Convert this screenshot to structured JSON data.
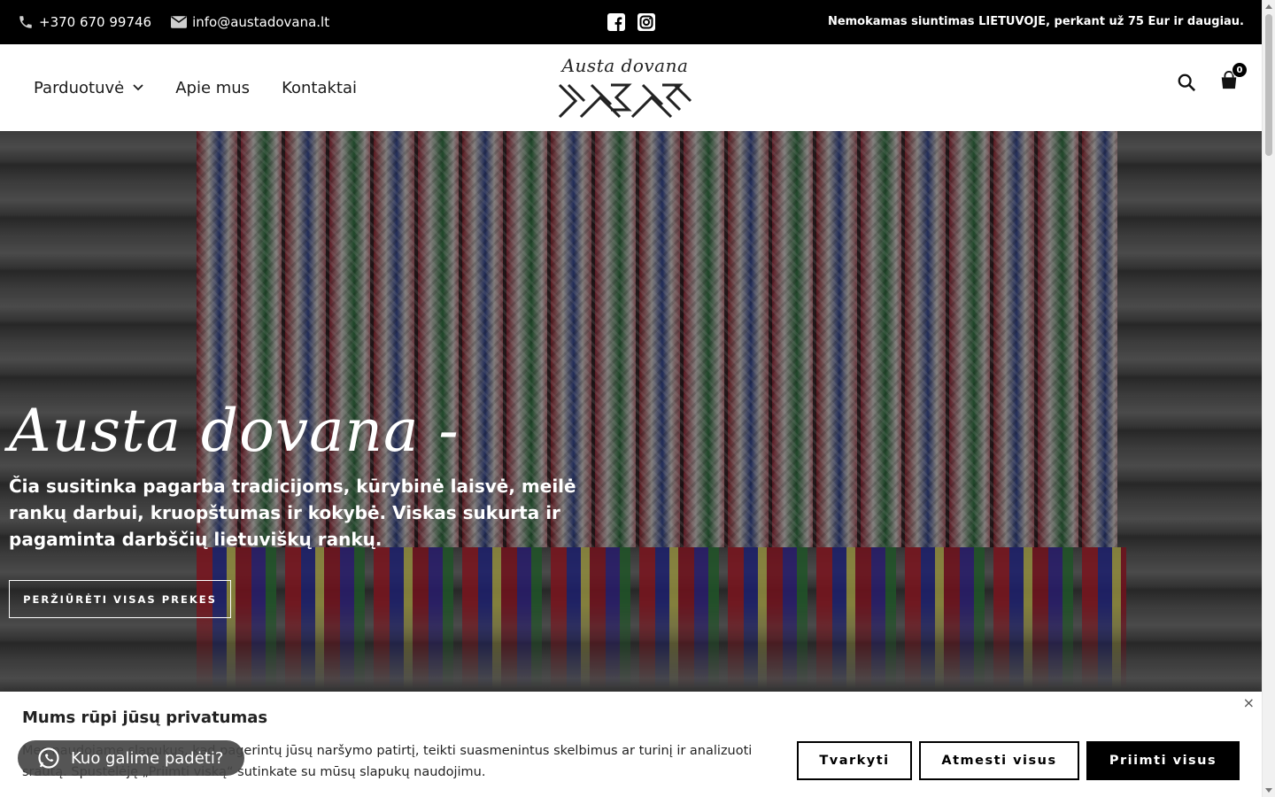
{
  "topbar": {
    "phone": "+370 670 99746",
    "email": "info@austadovana.lt",
    "notice": "Nemokamas siuntimas LIETUVOJE, perkant už 75 Eur ir daugiau.",
    "social": [
      "facebook-icon",
      "instagram-icon"
    ]
  },
  "header": {
    "nav": [
      {
        "label": "Parduotuvė",
        "dropdown": true
      },
      {
        "label": "Apie mus"
      },
      {
        "label": "Kontaktai"
      }
    ],
    "logo_text": "Austa dovana",
    "cart_count": "0"
  },
  "hero": {
    "title": "Austa dovana -",
    "subtitle": "Čia susitinka pagarba tradicijoms, kūrybinė laisvė, meilė rankų darbui, kruopštumas ir kokybė. Viskas sukurta ir pagaminta darbščių lietuviškų rankų.",
    "button": "PERŽIŪRĖTI VISAS PREKES"
  },
  "cookie": {
    "title": "Mums rūpi jūsų privatumas",
    "text": "Mes naudojame slapukus, kad pagerintų jūsų naršymo patirtį, teikti suasmenintus skelbimus ar turinį ir analizuoti srautą. Spustelėję „Priimti viską“ sutinkate su mūsų slapukų naudojimu.",
    "buttons": {
      "customize": "Tvarkyti",
      "reject": "Atmesti visus",
      "accept": "Priimti visus"
    },
    "close": "×"
  },
  "whatsapp": {
    "label": "Kuo galime padėti?"
  },
  "colors": {
    "topbar": "#000000",
    "accent": "#000000",
    "text": "#1a1a1a"
  }
}
